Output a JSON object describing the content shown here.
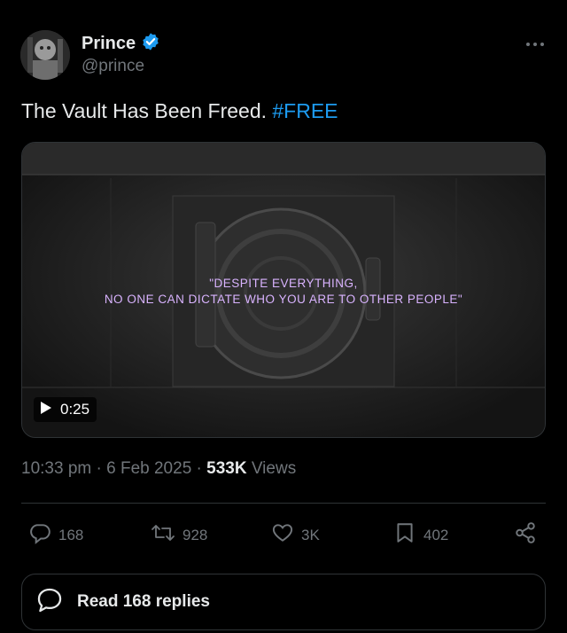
{
  "post": {
    "author": {
      "name": "Prince",
      "handle": "@prince",
      "verified": true
    },
    "text": "The Vault Has Been Freed.",
    "hashtag": "#FREE",
    "media": {
      "quote_line1": "\"DESPITE EVERYTHING,",
      "quote_line2": "NO ONE CAN DICTATE WHO YOU ARE TO OTHER PEOPLE\"",
      "duration": "0:25"
    },
    "meta": {
      "time": "10:33 pm",
      "sep1": " · ",
      "date": "6 Feb 2025",
      "sep2": " · ",
      "views_count": "533K",
      "views_label": " Views"
    },
    "actions": {
      "replies": "168",
      "reposts": "928",
      "likes": "3K",
      "bookmarks": "402"
    },
    "read_replies": "Read 168 replies"
  },
  "colors": {
    "accent": "#1d9bf0",
    "muted": "#71767b",
    "quote": "#d9b3ff"
  },
  "icons": [
    "verified-badge-icon",
    "more-icon",
    "play-icon",
    "reply-icon",
    "repost-icon",
    "like-icon",
    "bookmark-icon",
    "share-icon",
    "speech-bubble-icon"
  ]
}
